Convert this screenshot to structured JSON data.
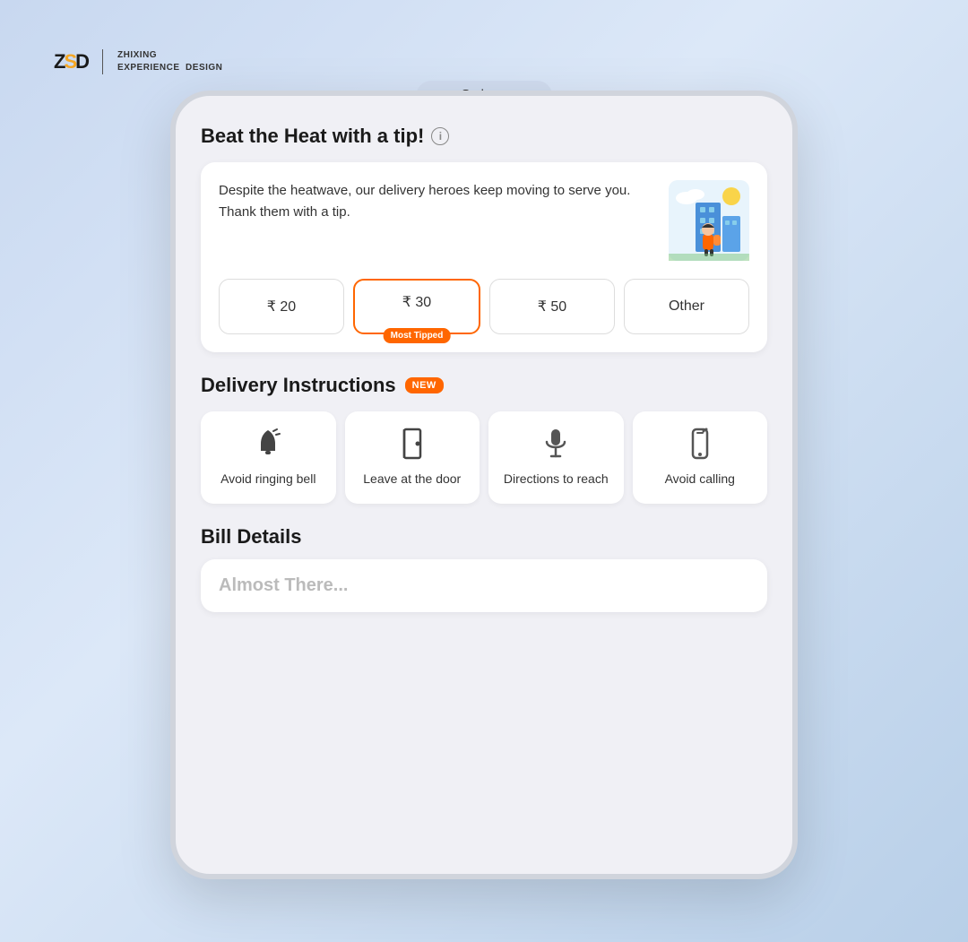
{
  "logo": {
    "text": "ZSD",
    "company": "ZHIXING\nEXPERIENCE  DESIGN"
  },
  "tab": {
    "label": "Swiggy"
  },
  "heat_section": {
    "title": "Beat the Heat with a tip!",
    "description": "Despite the heatwave, our delivery heroes keep moving to serve you. Thank them with a tip.",
    "tip_buttons": [
      {
        "amount": "₹ 20",
        "selected": false,
        "badge": null
      },
      {
        "amount": "₹ 30",
        "selected": true,
        "badge": "Most Tipped"
      },
      {
        "amount": "₹ 50",
        "selected": false,
        "badge": null
      },
      {
        "amount": "Other",
        "selected": false,
        "badge": null
      }
    ]
  },
  "delivery_instructions": {
    "title": "Delivery Instructions",
    "new_badge": "NEW",
    "items": [
      {
        "label": "Avoid ringing bell",
        "icon": "bell"
      },
      {
        "label": "Leave at the door",
        "icon": "door"
      },
      {
        "label": "Directions to reach",
        "icon": "mic"
      },
      {
        "label": "Avoid calling",
        "icon": "phone"
      }
    ]
  },
  "bill_details": {
    "title": "Bill Details",
    "almost_text": "Almost There..."
  }
}
